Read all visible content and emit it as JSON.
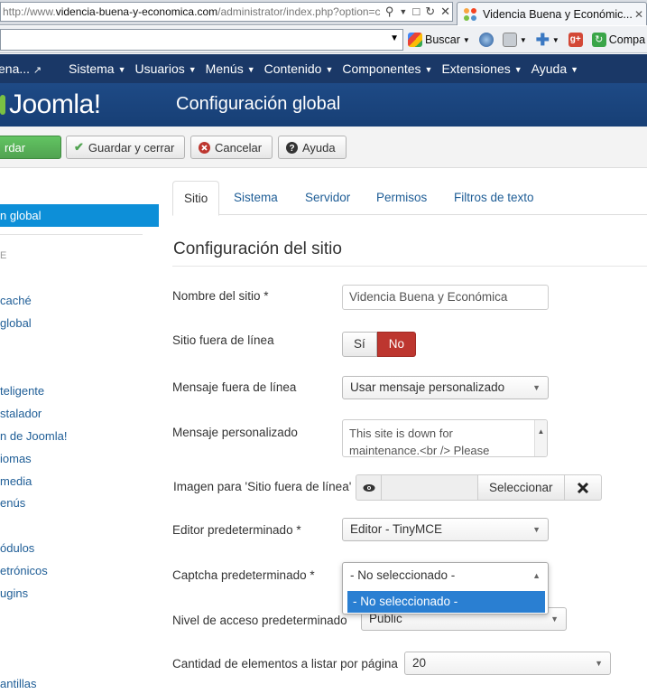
{
  "browser": {
    "address_prefix": "http://www.",
    "address_host": "videncia-buena-y-economica.com",
    "address_rest": "/administrator/index.php?option=c",
    "tab_title": "Videncia Buena y Económic...",
    "search_label": "Buscar",
    "share_label": "Compa"
  },
  "nav": {
    "brand": "ena...",
    "items": [
      "Sistema",
      "Usuarios",
      "Menús",
      "Contenido",
      "Componentes",
      "Extensiones",
      "Ayuda"
    ]
  },
  "header": {
    "logo_text": "Joomla!",
    "title": "Configuración global"
  },
  "toolbar": {
    "save": "rdar",
    "save_close": "Guardar y cerrar",
    "cancel": "Cancelar",
    "help": "Ayuda"
  },
  "sidebar": {
    "active": "n global",
    "heading": "E",
    "links": [
      "caché",
      "global",
      "teligente",
      "stalador",
      "n de Joomla!",
      "iomas",
      "media",
      "enús",
      "ódulos",
      "etrónicos",
      "ugins",
      "antillas"
    ]
  },
  "tabs": [
    "Sitio",
    "Sistema",
    "Servidor",
    "Permisos",
    "Filtros de texto"
  ],
  "section_title": "Configuración del sitio",
  "form": {
    "site_name_label": "Nombre del sitio *",
    "site_name_value": "Videncia Buena y Económica",
    "offline_label": "Sitio fuera de línea",
    "offline_yes": "Sí",
    "offline_no": "No",
    "offline_msg_label": "Mensaje fuera de línea",
    "offline_msg_value": "Usar mensaje personalizado",
    "custom_msg_label": "Mensaje personalizado",
    "custom_msg_line1": "This site is down for",
    "custom_msg_line2": "maintenance.<br /> Please",
    "offline_image_label": "Imagen para 'Sitio fuera de línea'",
    "select_button": "Seleccionar",
    "editor_label": "Editor predeterminado *",
    "editor_value": "Editor - TinyMCE",
    "captcha_label": "Captcha predeterminado *",
    "captcha_value": "- No seleccionado -",
    "captcha_option": "- No seleccionado -",
    "access_label": "Nivel de acceso predeterminado",
    "access_value": "Public",
    "list_limit_label": "Cantidad de elementos a listar por página",
    "list_limit_value": "20"
  },
  "colors": {
    "navbar": "#1a3867",
    "active_blue": "#0d8fd8",
    "save_green": "#51a351",
    "no_red": "#bd362f"
  }
}
